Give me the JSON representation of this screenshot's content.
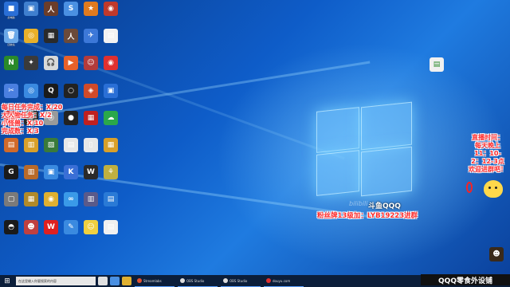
{
  "desktop_icons": [
    {
      "label": "此电脑",
      "color": "#2a6fd6",
      "glyph": "■"
    },
    {
      "label": "",
      "color": "#3f7fcf",
      "glyph": "▣"
    },
    {
      "label": "",
      "color": "#6b3d2a",
      "glyph": "人"
    },
    {
      "label": "",
      "color": "#4a90e2",
      "glyph": "S"
    },
    {
      "label": "",
      "color": "#e07a1f",
      "glyph": "★"
    },
    {
      "label": "",
      "color": "#c0392b",
      "glyph": "◉"
    },
    {
      "label": "回收站",
      "color": "#6aa8e8",
      "glyph": "🗑"
    },
    {
      "label": "",
      "color": "#e8b02a",
      "glyph": "◎"
    },
    {
      "label": "",
      "color": "#2a2a2a",
      "glyph": "▦"
    },
    {
      "label": "",
      "color": "#6b4a3a",
      "glyph": "人"
    },
    {
      "label": "",
      "color": "#3c78d8",
      "glyph": "✈"
    },
    {
      "label": "",
      "color": "#f2f2f2",
      "glyph": "▤"
    },
    {
      "label": "",
      "color": "#2a8a2a",
      "glyph": "N"
    },
    {
      "label": "",
      "color": "#3a3a3a",
      "glyph": "✦"
    },
    {
      "label": "",
      "color": "#d9d9d9",
      "glyph": "🎧"
    },
    {
      "label": "",
      "color": "#e8612a",
      "glyph": "▶"
    },
    {
      "label": "",
      "color": "#b33b3b",
      "glyph": "☺"
    },
    {
      "label": "",
      "color": "#e03030",
      "glyph": "◉"
    },
    {
      "label": "",
      "color": "#4a7fe0",
      "glyph": "✂"
    },
    {
      "label": "",
      "color": "#3a8ae0",
      "glyph": "◎"
    },
    {
      "label": "",
      "color": "#1a1a1a",
      "glyph": "Q"
    },
    {
      "label": "",
      "color": "#222222",
      "glyph": "○"
    },
    {
      "label": "",
      "color": "#d04a2a",
      "glyph": "◈"
    },
    {
      "label": "",
      "color": "#2a6fd6",
      "glyph": "▣"
    },
    {
      "label": "",
      "color": "#e04040",
      "glyph": "♪"
    },
    {
      "label": "",
      "color": "#2a2a2a",
      "glyph": "✦"
    },
    {
      "label": "",
      "color": "#9a9a9a",
      "glyph": "◎"
    },
    {
      "label": "",
      "color": "#222222",
      "glyph": "●"
    },
    {
      "label": "",
      "color": "#c02020",
      "glyph": "▦"
    },
    {
      "label": "",
      "color": "#2aa84a",
      "glyph": "☁"
    },
    {
      "label": "",
      "color": "#d06a2a",
      "glyph": "▤"
    },
    {
      "label": "",
      "color": "#d9a02a",
      "glyph": "▥"
    },
    {
      "label": "",
      "color": "#3a7a3a",
      "glyph": "▧"
    },
    {
      "label": "",
      "color": "#e8e8e8",
      "glyph": "▤"
    },
    {
      "label": "",
      "color": "#e8e8e8",
      "glyph": "▯"
    },
    {
      "label": "",
      "color": "#d9a02a",
      "glyph": "▦"
    },
    {
      "label": "",
      "color": "#1a1a1a",
      "glyph": "G"
    },
    {
      "label": "",
      "color": "#b86a2a",
      "glyph": "▥"
    },
    {
      "label": "",
      "color": "#3a8ae0",
      "glyph": "▣"
    },
    {
      "label": "",
      "color": "#3a6fd6",
      "glyph": "K"
    },
    {
      "label": "",
      "color": "#2a2a2a",
      "glyph": "W"
    },
    {
      "label": "",
      "color": "#c0b040",
      "glyph": "⚘"
    },
    {
      "label": "",
      "color": "#7a7a7a",
      "glyph": "▢"
    },
    {
      "label": "",
      "color": "#b08a2a",
      "glyph": "▦"
    },
    {
      "label": "",
      "color": "#e0b030",
      "glyph": "◉"
    },
    {
      "label": "",
      "color": "#3a9ae8",
      "glyph": "∞"
    },
    {
      "label": "",
      "color": "#5a5a8a",
      "glyph": "▥"
    },
    {
      "label": "",
      "color": "#2a7ad6",
      "glyph": "▤"
    },
    {
      "label": "",
      "color": "#1a1a1a",
      "glyph": "◓"
    },
    {
      "label": "",
      "color": "#c04040",
      "glyph": "☻"
    },
    {
      "label": "",
      "color": "#e02020",
      "glyph": "W"
    },
    {
      "label": "",
      "color": "#3a8ae0",
      "glyph": "✎"
    },
    {
      "label": "",
      "color": "#f0d040",
      "glyph": "☺"
    },
    {
      "label": "",
      "color": "#f0f0f0",
      "glyph": "▤"
    }
  ],
  "overlay": {
    "left_lines": [
      "每日任务完成：X/20",
      "大人物任务：X/2",
      "小怪兽：X/10",
      "完成数：X/3"
    ],
    "stream_name": "斗鱼QQQ",
    "fan_line": "粉丝牌13级加：LYB19223进群",
    "right_lines": [
      "直播时间：",
      "每天晚上",
      "11：10-",
      "2：12-3点",
      "欢迎进群吧！"
    ],
    "banner": "QQQ零食外设铺"
  },
  "taskbar": {
    "search_placeholder": "在这里输入你要搜索的内容",
    "apps": [
      {
        "label": "Streamlabs",
        "color": "#e05030"
      },
      {
        "label": "OBS Studio",
        "color": "#dddddd"
      },
      {
        "label": "OBS Studio",
        "color": "#dddddd"
      },
      {
        "label": "douyu.com",
        "color": "#e03030"
      }
    ]
  },
  "watermark": "bilibili"
}
